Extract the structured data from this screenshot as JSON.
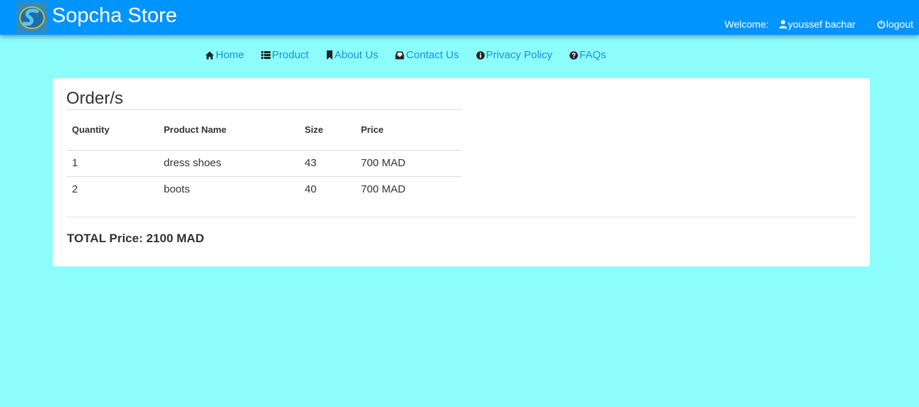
{
  "header": {
    "brand": "Sopcha Store",
    "welcome_label": "Welcome:",
    "user_name": "youssef bachar",
    "logout_label": "logout"
  },
  "menu": {
    "items": [
      {
        "label": "Home",
        "icon": "home-icon"
      },
      {
        "label": "Product",
        "icon": "list-icon"
      },
      {
        "label": "About Us",
        "icon": "bookmark-icon"
      },
      {
        "label": "Contact Us",
        "icon": "inbox-icon"
      },
      {
        "label": "Privacy Policy",
        "icon": "info-icon"
      },
      {
        "label": "FAQs",
        "icon": "question-icon"
      }
    ]
  },
  "orders": {
    "title": "Order/s",
    "columns": [
      "Quantity",
      "Product Name",
      "Size",
      "Price"
    ],
    "rows": [
      {
        "quantity": "1",
        "product_name": "dress shoes",
        "size": "43",
        "price": "700 MAD"
      },
      {
        "quantity": "2",
        "product_name": "boots",
        "size": "40",
        "price": "700 MAD"
      }
    ],
    "total": "TOTAL Price: 2100 MAD"
  },
  "colors": {
    "page_background": "#8cfdfb",
    "navbar": "#0094ff",
    "link": "#1a8fd8"
  }
}
